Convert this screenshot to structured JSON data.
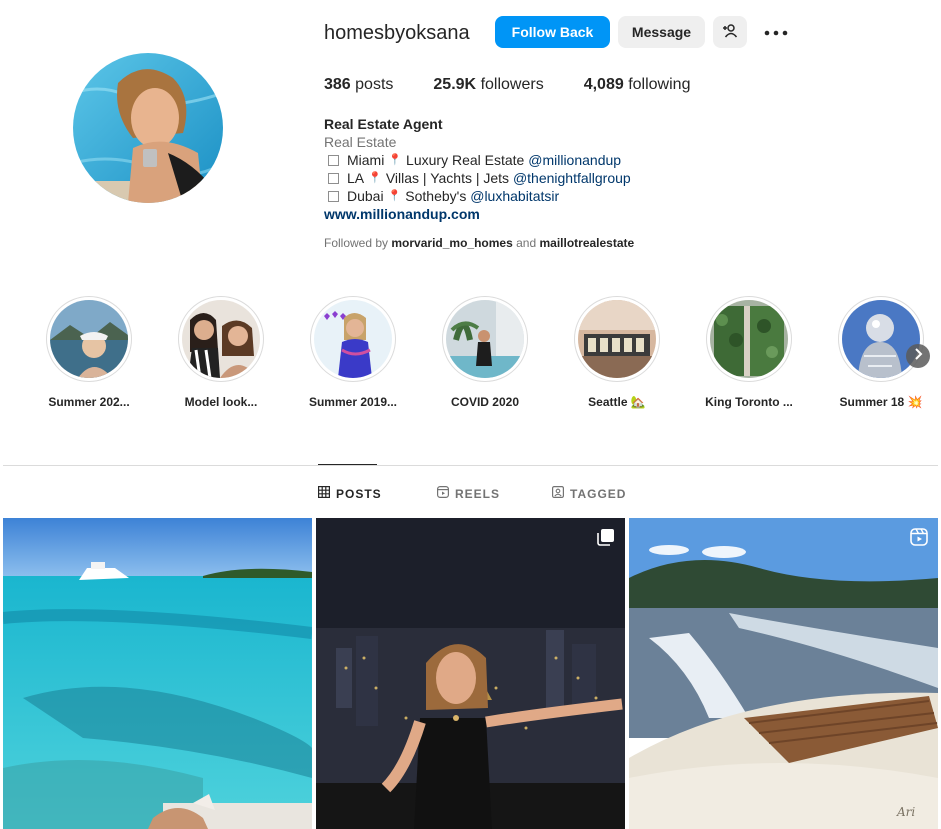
{
  "profile": {
    "username": "homesbyoksana",
    "follow_label": "Follow Back",
    "message_label": "Message",
    "stats": {
      "posts_count": "386",
      "posts_label": "posts",
      "followers_count": "25.9K",
      "followers_label": "followers",
      "following_count": "4,089",
      "following_label": "following"
    },
    "bio": {
      "name": "Real Estate Agent",
      "category": "Real Estate",
      "lines": [
        {
          "place": "Miami",
          "text": "Luxury Real Estate",
          "mention": "@millionandup"
        },
        {
          "place": "LA",
          "text": "Villas | Yachts | Jets",
          "mention": "@thenightfallgroup"
        },
        {
          "place": "Dubai",
          "text": "Sotheby's",
          "mention": "@luxhabitatsir"
        }
      ],
      "website": "www.millionandup.com"
    },
    "followed_by": {
      "prefix": "Followed by",
      "user1": "morvarid_mo_homes",
      "joiner": "and",
      "user2": "maillotrealestate"
    }
  },
  "highlights": [
    {
      "label": "Summer 202..."
    },
    {
      "label": "Model look..."
    },
    {
      "label": "Summer 2019..."
    },
    {
      "label": "COVID 2020"
    },
    {
      "label": "Seattle 🏡"
    },
    {
      "label": "King Toronto ..."
    },
    {
      "label": "Summer 18 💥"
    }
  ],
  "tabs": [
    {
      "label": "POSTS",
      "icon": "grid-icon",
      "active": true
    },
    {
      "label": "REELS",
      "icon": "reels-icon",
      "active": false
    },
    {
      "label": "TAGGED",
      "icon": "tagged-icon",
      "active": false
    }
  ],
  "posts": [
    {
      "subject": "turquoise sea with yacht",
      "badge": ""
    },
    {
      "subject": "woman at night city rooftop",
      "badge": "carousel-icon"
    },
    {
      "subject": "boat wake on lake",
      "badge": "reel-icon"
    }
  ],
  "colors": {
    "accent": "#0095f6",
    "button_gray": "#efefef",
    "mention": "#00376b",
    "secondary_text": "#737373",
    "border": "#dbdbdb"
  }
}
